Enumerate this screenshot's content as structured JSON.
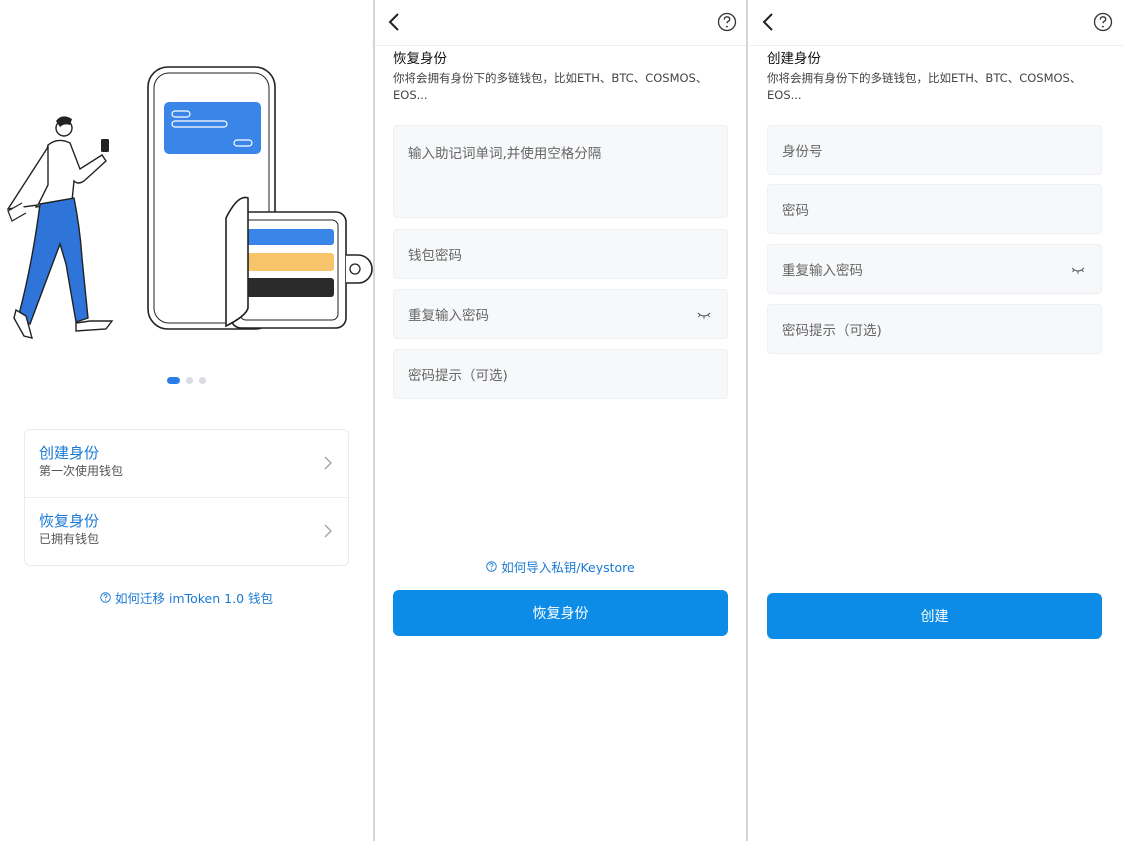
{
  "welcome": {
    "carousel_dots": 3,
    "menu": {
      "create": {
        "title": "创建身份",
        "subtitle": "第一次使用钱包"
      },
      "restore": {
        "title": "恢复身份",
        "subtitle": "已拥有钱包"
      }
    },
    "help_link": "如何迁移 imToken 1.0 钱包"
  },
  "restore": {
    "title": "恢复身份",
    "description": "你将会拥有身份下的多链钱包，比如ETH、BTC、COSMOS、EOS...",
    "mnemonic_placeholder": "输入助记词单词,并使用空格分隔",
    "password_placeholder": "钱包密码",
    "repeat_password_placeholder": "重复输入密码",
    "hint_placeholder": "密码提示（可选)",
    "help_link": "如何导入私钥/Keystore",
    "submit": "恢复身份"
  },
  "create": {
    "title": "创建身份",
    "description": "你将会拥有身份下的多链钱包，比如ETH、BTC、COSMOS、EOS...",
    "identity_placeholder": "身份号",
    "password_placeholder": "密码",
    "repeat_password_placeholder": "重复输入密码",
    "hint_placeholder": "密码提示（可选)",
    "submit": "创建"
  },
  "colors": {
    "accent": "#0c8ce6",
    "link": "#1a7ad4",
    "card_blue": "#3a86e8",
    "card_yellow": "#f7c46c",
    "card_black": "#2b2b2b",
    "pants_blue": "#2f74d8"
  },
  "icons": [
    "back-arrow-icon",
    "help-circle-icon",
    "chevron-right-icon",
    "eye-closed-icon",
    "question-circle-icon"
  ]
}
